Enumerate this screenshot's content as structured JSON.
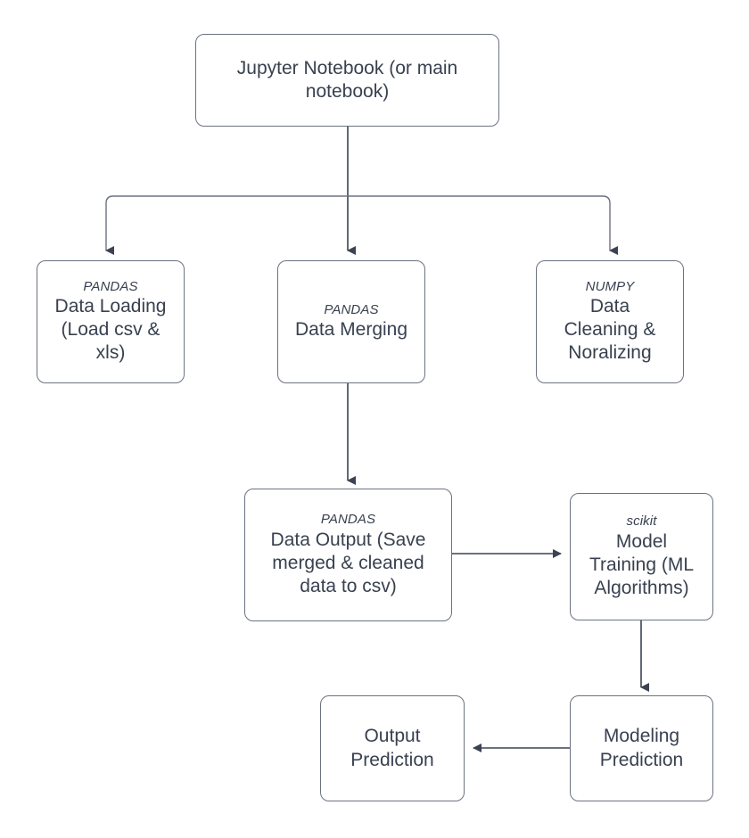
{
  "diagram": {
    "title": "Data Science Pipeline Flowchart",
    "background_color": "#ffffff",
    "node_border_color": "#6b7280",
    "text_color": "#394150",
    "edge_color": "#3b4252"
  },
  "nodes": {
    "notebook": {
      "lib": "",
      "title": "Jupyter Notebook (or main\nnotebook)"
    },
    "data_loading": {
      "lib": "PANDAS",
      "title": "Data Loading\n(Load csv &\nxls)"
    },
    "data_merging": {
      "lib": "PANDAS",
      "title": "Data Merging"
    },
    "data_cleaning": {
      "lib": "NUMPY",
      "title": "Data\nCleaning &\nNoralizing"
    },
    "data_output": {
      "lib": "PANDAS",
      "title": "Data Output (Save\nmerged & cleaned\ndata to csv)"
    },
    "model_training": {
      "lib": "scikit",
      "title": "Model\nTraining (ML\nAlgorithms)"
    },
    "modeling_prediction": {
      "lib": "",
      "title": "Modeling\nPrediction"
    },
    "output_prediction": {
      "lib": "",
      "title": "Output\nPrediction"
    }
  },
  "edges": [
    {
      "from": "notebook",
      "to": "data_loading",
      "style": "elbow-down-left"
    },
    {
      "from": "notebook",
      "to": "data_merging",
      "style": "straight-down"
    },
    {
      "from": "notebook",
      "to": "data_cleaning",
      "style": "elbow-down-right"
    },
    {
      "from": "data_merging",
      "to": "data_output",
      "style": "straight-down"
    },
    {
      "from": "data_output",
      "to": "model_training",
      "style": "straight-right"
    },
    {
      "from": "model_training",
      "to": "modeling_prediction",
      "style": "straight-down"
    },
    {
      "from": "modeling_prediction",
      "to": "output_prediction",
      "style": "straight-left"
    }
  ]
}
